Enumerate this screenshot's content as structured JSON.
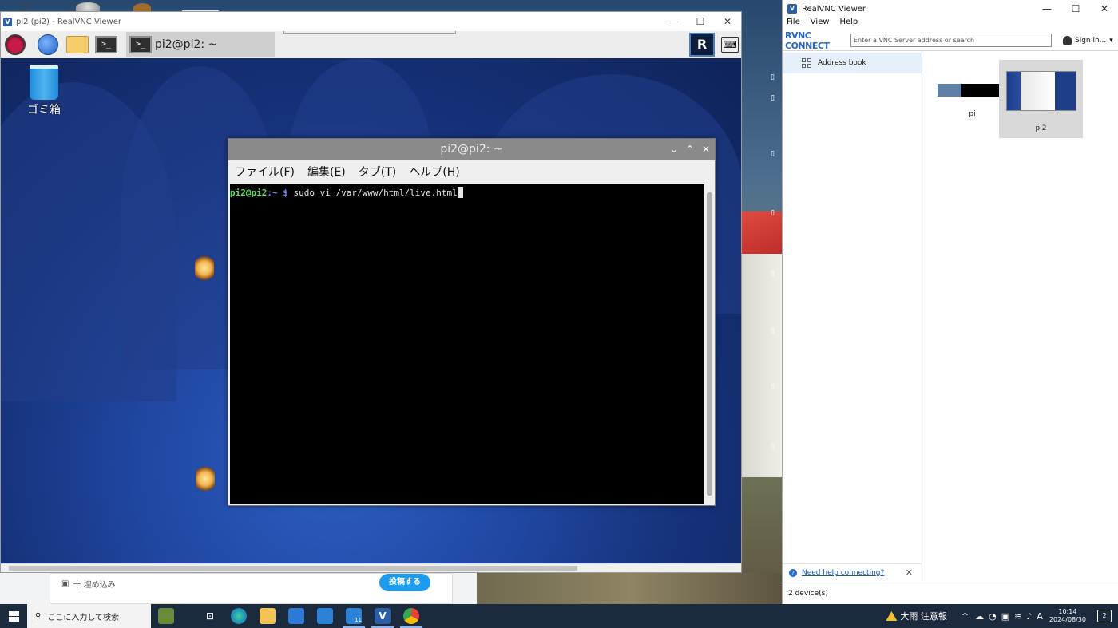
{
  "vnc_window": {
    "title": "pi2 (pi2) - RealVNC Viewer",
    "controls": {
      "minimize": "—",
      "maximize": "☐",
      "close": "✕"
    }
  },
  "pi_panel": {
    "task_label": "pi2@pi2: ~",
    "terminal_glyph": ">_",
    "vnc_logo": "R",
    "keyboard_glyph": "⌨"
  },
  "pi_desktop": {
    "trash_label": "ゴミ箱"
  },
  "terminal": {
    "title": "pi2@pi2: ~",
    "controls": {
      "minimize": "⌄",
      "maximize": "⌃",
      "close": "✕"
    },
    "menu": [
      "ファイル(F)",
      "編集(E)",
      "タブ(T)",
      "ヘルプ(H)"
    ],
    "prompt_user": "pi2@pi2",
    "prompt_path": ":~ $ ",
    "command": "sudo vi /var/www/html/live.html"
  },
  "background_browser": {
    "embed_label": "十 埋め込み",
    "post_button": "投稿する"
  },
  "realvnc": {
    "title": "RealVNC Viewer",
    "controls": {
      "minimize": "—",
      "maximize": "☐",
      "close": "✕"
    },
    "menu": [
      "File",
      "View",
      "Help"
    ],
    "brand": "RVNC CONNECT",
    "search_placeholder": "Enter a VNC Server address or search",
    "sign_in": "Sign in...",
    "sign_in_caret": "▾",
    "address_book": "Address book",
    "devices": [
      {
        "name": "pi",
        "selected": false
      },
      {
        "name": "pi2",
        "selected": true
      }
    ],
    "help_link": "Need help connecting?",
    "help_close": "✕",
    "status": "2 device(s)"
  },
  "taskbar": {
    "search_placeholder": "ここに入力して検索",
    "mail_badge": "11",
    "weather": "大雨 注意報",
    "ime": "A",
    "time": "10:14",
    "date": "2024/08/30",
    "notification_count": "2",
    "tray_up": "^"
  }
}
